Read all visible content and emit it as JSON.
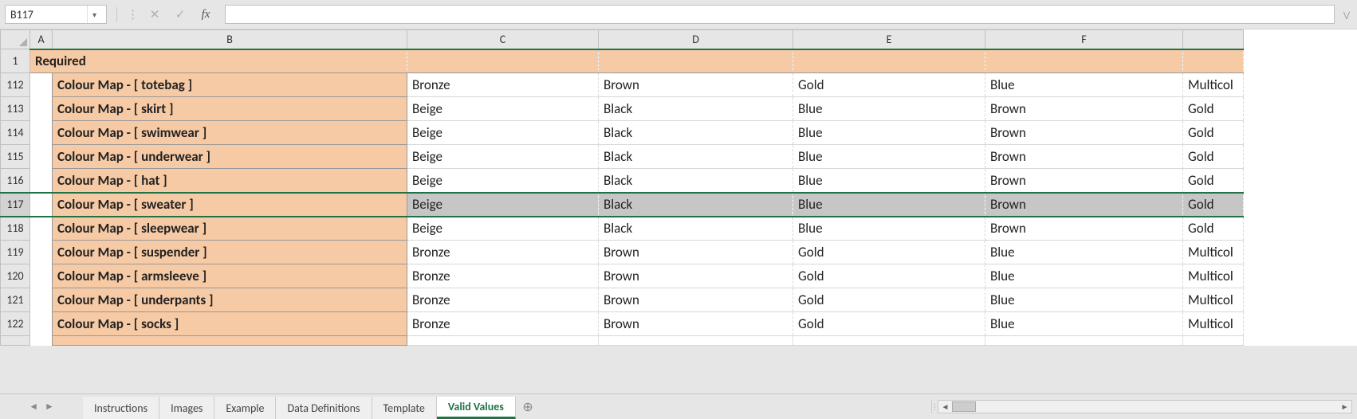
{
  "nameBox": "B117",
  "formula": "",
  "columns": [
    "A",
    "B",
    "C",
    "D",
    "E",
    "F",
    ""
  ],
  "headerRow": {
    "num": "1",
    "label": "Required"
  },
  "rows": [
    {
      "num": "112",
      "b": "Colour Map - [ totebag ]",
      "c": "Bronze",
      "d": "Brown",
      "e": "Gold",
      "f": "Blue",
      "g": "Multicol"
    },
    {
      "num": "113",
      "b": "Colour Map - [ skirt ]",
      "c": "Beige",
      "d": "Black",
      "e": "Blue",
      "f": "Brown",
      "g": "Gold"
    },
    {
      "num": "114",
      "b": "Colour Map - [ swimwear ]",
      "c": "Beige",
      "d": "Black",
      "e": "Blue",
      "f": "Brown",
      "g": "Gold"
    },
    {
      "num": "115",
      "b": "Colour Map - [ underwear ]",
      "c": "Beige",
      "d": "Black",
      "e": "Blue",
      "f": "Brown",
      "g": "Gold"
    },
    {
      "num": "116",
      "b": "Colour Map - [ hat ]",
      "c": "Beige",
      "d": "Black",
      "e": "Blue",
      "f": "Brown",
      "g": "Gold"
    },
    {
      "num": "117",
      "b": "Colour Map - [ sweater ]",
      "c": "Beige",
      "d": "Black",
      "e": "Blue",
      "f": "Brown",
      "g": "Gold",
      "selected": true
    },
    {
      "num": "118",
      "b": "Colour Map - [ sleepwear ]",
      "c": "Beige",
      "d": "Black",
      "e": "Blue",
      "f": "Brown",
      "g": "Gold"
    },
    {
      "num": "119",
      "b": "Colour Map - [ suspender ]",
      "c": "Bronze",
      "d": "Brown",
      "e": "Gold",
      "f": "Blue",
      "g": "Multicol"
    },
    {
      "num": "120",
      "b": "Colour Map - [ armsleeve ]",
      "c": "Bronze",
      "d": "Brown",
      "e": "Gold",
      "f": "Blue",
      "g": "Multicol"
    },
    {
      "num": "121",
      "b": "Colour Map - [ underpants ]",
      "c": "Bronze",
      "d": "Brown",
      "e": "Gold",
      "f": "Blue",
      "g": "Multicol"
    },
    {
      "num": "122",
      "b": "Colour Map - [ socks ]",
      "c": "Bronze",
      "d": "Brown",
      "e": "Gold",
      "f": "Blue",
      "g": "Multicol"
    }
  ],
  "tabs": [
    {
      "label": "Instructions",
      "active": false
    },
    {
      "label": "Images",
      "active": false
    },
    {
      "label": "Example",
      "active": false
    },
    {
      "label": "Data Definitions",
      "active": false
    },
    {
      "label": "Template",
      "active": false
    },
    {
      "label": "Valid Values",
      "active": true
    }
  ],
  "icons": {
    "cancel": "✕",
    "accept": "✓",
    "fx": "fx",
    "dropdown": "▾",
    "newtab": "⊕",
    "left": "◄",
    "right": "►",
    "dots": "⋮"
  }
}
